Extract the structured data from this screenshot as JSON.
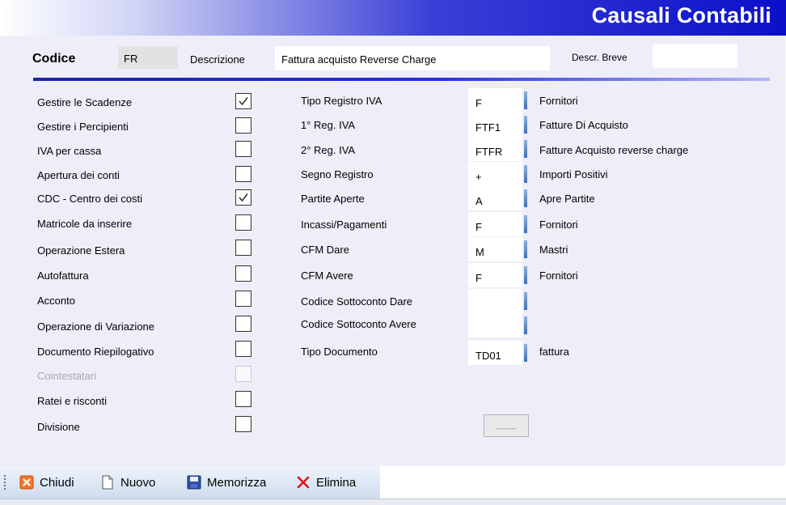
{
  "window": {
    "title": "Causali Contabili"
  },
  "header": {
    "codice_label": "Codice",
    "codice_value": "FR",
    "descrizione_label": "Descrizione",
    "descrizione_value": "Fattura acquisto Reverse Charge",
    "descr_breve_label": "Descr. Breve",
    "descr_breve_value": ""
  },
  "flags": [
    {
      "label": "Gestire le Scadenze",
      "checked": true,
      "enabled": true
    },
    {
      "label": "Gestire i Percipienti",
      "checked": false,
      "enabled": true
    },
    {
      "label": "IVA per cassa",
      "checked": false,
      "enabled": true
    },
    {
      "label": "Apertura dei conti",
      "checked": false,
      "enabled": true
    },
    {
      "label": "CDC - Centro dei costi",
      "checked": true,
      "enabled": true
    },
    {
      "label": "Matricole da inserire",
      "checked": false,
      "enabled": true
    },
    {
      "label": "Operazione Estera",
      "checked": false,
      "enabled": true
    },
    {
      "label": "Autofattura",
      "checked": false,
      "enabled": true
    },
    {
      "label": "Acconto",
      "checked": false,
      "enabled": true
    },
    {
      "label": "Operazione di Variazione",
      "checked": false,
      "enabled": true
    },
    {
      "label": "Documento Riepilogativo",
      "checked": false,
      "enabled": true
    },
    {
      "label": "Cointestatari",
      "checked": false,
      "enabled": false
    },
    {
      "label": "Ratei e risconti",
      "checked": false,
      "enabled": true
    },
    {
      "label": "Divisione",
      "checked": false,
      "enabled": true
    }
  ],
  "fields": [
    {
      "label": "Tipo Registro IVA",
      "value": "F",
      "description": "Fornitori"
    },
    {
      "label": "1° Reg. IVA",
      "value": "FTF1",
      "description": "Fatture Di Acquisto"
    },
    {
      "label": "2° Reg. IVA",
      "value": "FTFR",
      "description": "Fatture Acquisto reverse charge"
    },
    {
      "label": "Segno Registro",
      "value": "+",
      "description": "Importi Positivi"
    },
    {
      "label": "Partite Aperte",
      "value": "A",
      "description": "Apre Partite"
    },
    {
      "label": "Incassi/Pagamenti",
      "value": "F",
      "description": "Fornitori"
    },
    {
      "label": "CFM Dare",
      "value": "M",
      "description": "Mastri"
    },
    {
      "label": "CFM Avere",
      "value": "F",
      "description": "Fornitori"
    },
    {
      "label": "Codice Sottoconto Dare",
      "value": "",
      "description": ""
    },
    {
      "label": "Codice Sottoconto  Avere",
      "value": "",
      "description": ""
    },
    {
      "label": "Tipo Documento",
      "value": "TD01",
      "description": "fattura"
    }
  ],
  "small_button": {
    "label": "____"
  },
  "toolbar": {
    "chiudi": "Chiudi",
    "nuovo": "Nuovo",
    "memorizza": "Memorizza",
    "elimina": "Elimina"
  },
  "colors": {
    "title_gradient_end": "#0b10c9",
    "panel_bg": "#eeeef9",
    "accent_line": "#2a2ee0"
  }
}
